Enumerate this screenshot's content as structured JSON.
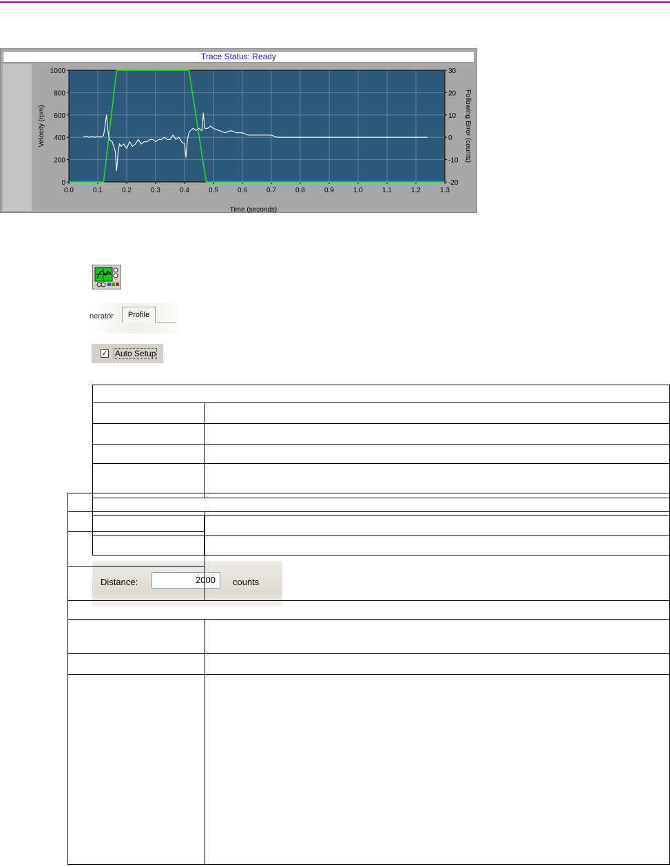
{
  "trace": {
    "status_text": "Trace Status:  Ready"
  },
  "chart_data": {
    "type": "line",
    "xlabel": "Time (seconds)",
    "ylabel": "Velocity (rpm)",
    "y2label": "Following Error (counts)",
    "xlim": [
      0.0,
      1.3
    ],
    "ylim": [
      0,
      1000
    ],
    "y2lim": [
      -20,
      30
    ],
    "x_ticks": [
      "0.0",
      "0.1",
      "0.2",
      "0.3",
      "0.4",
      "0.5",
      "0.6",
      "0.7",
      "0.8",
      "0.9",
      "1.0",
      "1.1",
      "1.2",
      "1.3"
    ],
    "y_ticks": [
      "0",
      "200",
      "400",
      "600",
      "800",
      "1000"
    ],
    "y2_ticks": [
      "-20",
      "-10",
      "0",
      "10",
      "20",
      "30"
    ],
    "grid": true,
    "background": "#2d5a7b",
    "series": [
      {
        "color": "#22dd22",
        "axis": "left",
        "x": [
          0.0,
          0.12,
          0.165,
          0.415,
          0.475,
          1.3
        ],
        "y": [
          0,
          0,
          1000,
          1000,
          0,
          0
        ]
      },
      {
        "color": "#ffffff",
        "axis": "right",
        "x": [
          0.05,
          0.06,
          0.07,
          0.08,
          0.09,
          0.1,
          0.11,
          0.12,
          0.125,
          0.13,
          0.135,
          0.14,
          0.15,
          0.155,
          0.16,
          0.165,
          0.17,
          0.175,
          0.18,
          0.19,
          0.2,
          0.21,
          0.22,
          0.23,
          0.24,
          0.25,
          0.26,
          0.27,
          0.28,
          0.29,
          0.3,
          0.31,
          0.32,
          0.33,
          0.34,
          0.35,
          0.36,
          0.37,
          0.38,
          0.39,
          0.4,
          0.405,
          0.41,
          0.415,
          0.42,
          0.43,
          0.44,
          0.45,
          0.46,
          0.465,
          0.47,
          0.48,
          0.49,
          0.5,
          0.52,
          0.54,
          0.56,
          0.58,
          0.6,
          0.62,
          0.64,
          0.66,
          0.68,
          0.7,
          0.72,
          0.75,
          0.8,
          0.85,
          0.9,
          0.95,
          1.0,
          1.05,
          1.1,
          1.15,
          1.2,
          1.24
        ],
        "y": [
          0,
          0.5,
          0,
          0.3,
          0,
          0.4,
          0,
          0.8,
          5,
          10,
          3,
          -1,
          -2,
          -4,
          -6,
          -15,
          -7,
          -3,
          -4,
          -3,
          -5,
          -2,
          -4,
          -3,
          -1,
          -3,
          -2,
          -2,
          -1,
          -1,
          -2,
          -1,
          -1,
          0,
          -1,
          -1,
          1,
          -1,
          0,
          -2,
          -3,
          -9,
          -1,
          2,
          3,
          4,
          3,
          4,
          3,
          11,
          4,
          4,
          5,
          4,
          3,
          2,
          3,
          2,
          2,
          1,
          1,
          1,
          1,
          1,
          0,
          0,
          0,
          0,
          0,
          0,
          0,
          0,
          0,
          0,
          0,
          0
        ]
      }
    ]
  },
  "tabs": {
    "prev_label": "nerator",
    "active_label": "Profile"
  },
  "auto_setup": {
    "label": "Auto Setup",
    "checked": "✓"
  },
  "distance": {
    "label": "Distance:",
    "value": "2000",
    "unit": "counts"
  }
}
